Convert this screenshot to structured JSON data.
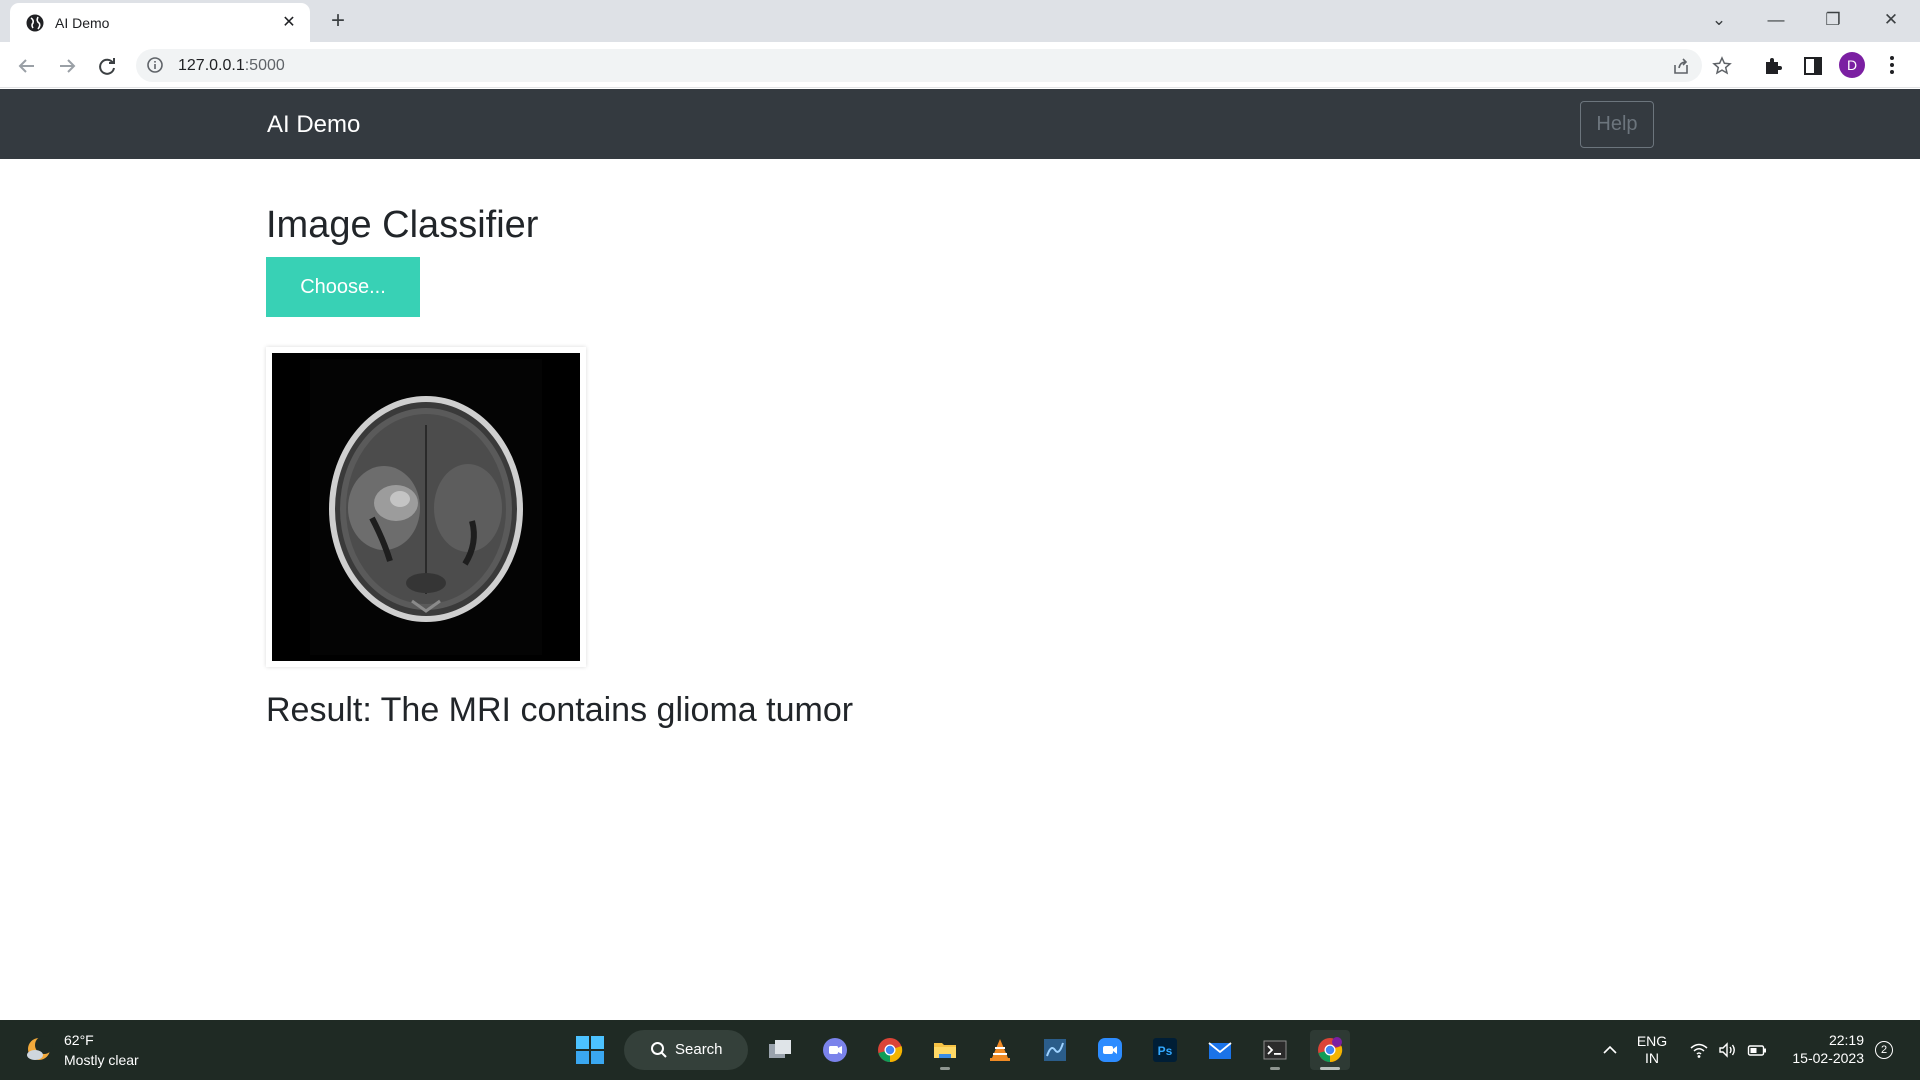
{
  "browser": {
    "tab": {
      "title": "AI Demo",
      "close_label": "✕"
    },
    "new_tab_label": "+",
    "window_controls": {
      "dropdown": "⌄",
      "minimize": "—",
      "restore": "❐",
      "close": "✕"
    },
    "address": {
      "host": "127.0.0.1",
      "port": ":5000"
    },
    "profile_initial": "D"
  },
  "navbar": {
    "brand": "AI Demo",
    "help_label": "Help"
  },
  "main": {
    "title": "Image Classifier",
    "choose_label": "Choose...",
    "result_text": "Result: The MRI contains glioma tumor"
  },
  "taskbar": {
    "weather": {
      "temperature": "62°F",
      "condition": "Mostly clear"
    },
    "search_label": "Search",
    "apps": [
      "task-view",
      "teams-chat",
      "chrome",
      "file-explorer",
      "vlc",
      "mysql-workbench",
      "zoom",
      "photoshop",
      "mail",
      "terminal",
      "chrome-profile"
    ],
    "photoshop_label": "Ps",
    "language": {
      "line1": "ENG",
      "line2": "IN"
    },
    "clock": {
      "time": "22:19",
      "date": "15-02-2023"
    },
    "notification_count": "2"
  },
  "colors": {
    "navbar_bg": "#343a40",
    "choose_button": "#38d1b5",
    "help_border": "#6c757d",
    "taskbar_bg": "#1f2a24",
    "profile_avatar": "#7b1fa2"
  }
}
